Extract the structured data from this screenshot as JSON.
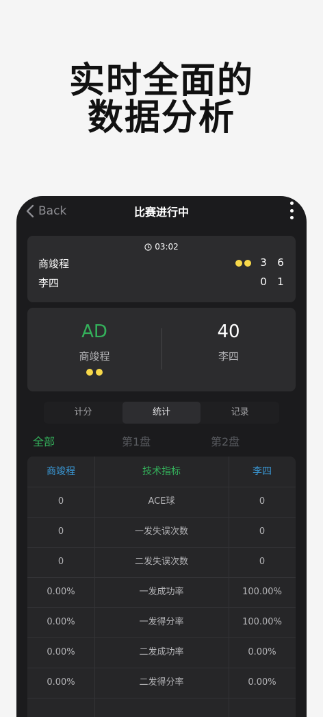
{
  "promo": {
    "line1": "实时全面的",
    "line2": "数据分析"
  },
  "nav": {
    "back_label": "Back",
    "title": "比赛进行中"
  },
  "score": {
    "timer": "03:02",
    "players": [
      {
        "name": "商竣程",
        "sets": [
          "3",
          "6"
        ],
        "serving": true
      },
      {
        "name": "李四",
        "sets": [
          "0",
          "1"
        ],
        "serving": false
      }
    ]
  },
  "game": {
    "left": {
      "point": "AD",
      "name": "商竣程"
    },
    "right": {
      "point": "40",
      "name": "李四"
    }
  },
  "segments": [
    {
      "label": "计分",
      "active": false
    },
    {
      "label": "统计",
      "active": true
    },
    {
      "label": "记录",
      "active": false
    }
  ],
  "set_tabs": [
    {
      "label": "全部",
      "active": true
    },
    {
      "label": "第1盘",
      "active": false
    },
    {
      "label": "第2盘",
      "active": false
    }
  ],
  "stats": {
    "headers": [
      "商竣程",
      "技术指标",
      "李四"
    ],
    "rows": [
      [
        "0",
        "ACE球",
        "0"
      ],
      [
        "0",
        "一发失误次数",
        "0"
      ],
      [
        "0",
        "二发失误次数",
        "0"
      ],
      [
        "0.00%",
        "一发成功率",
        "100.00%"
      ],
      [
        "0.00%",
        "一发得分率",
        "100.00%"
      ],
      [
        "0.00%",
        "二发成功率",
        "0.00%"
      ],
      [
        "0.00%",
        "二发得分率",
        "0.00%"
      ]
    ]
  },
  "colors": {
    "accent_green": "#34b15b",
    "accent_blue": "#3a9ad9",
    "serve_dot": "#f7d84a",
    "background": "#1b1b1d"
  }
}
